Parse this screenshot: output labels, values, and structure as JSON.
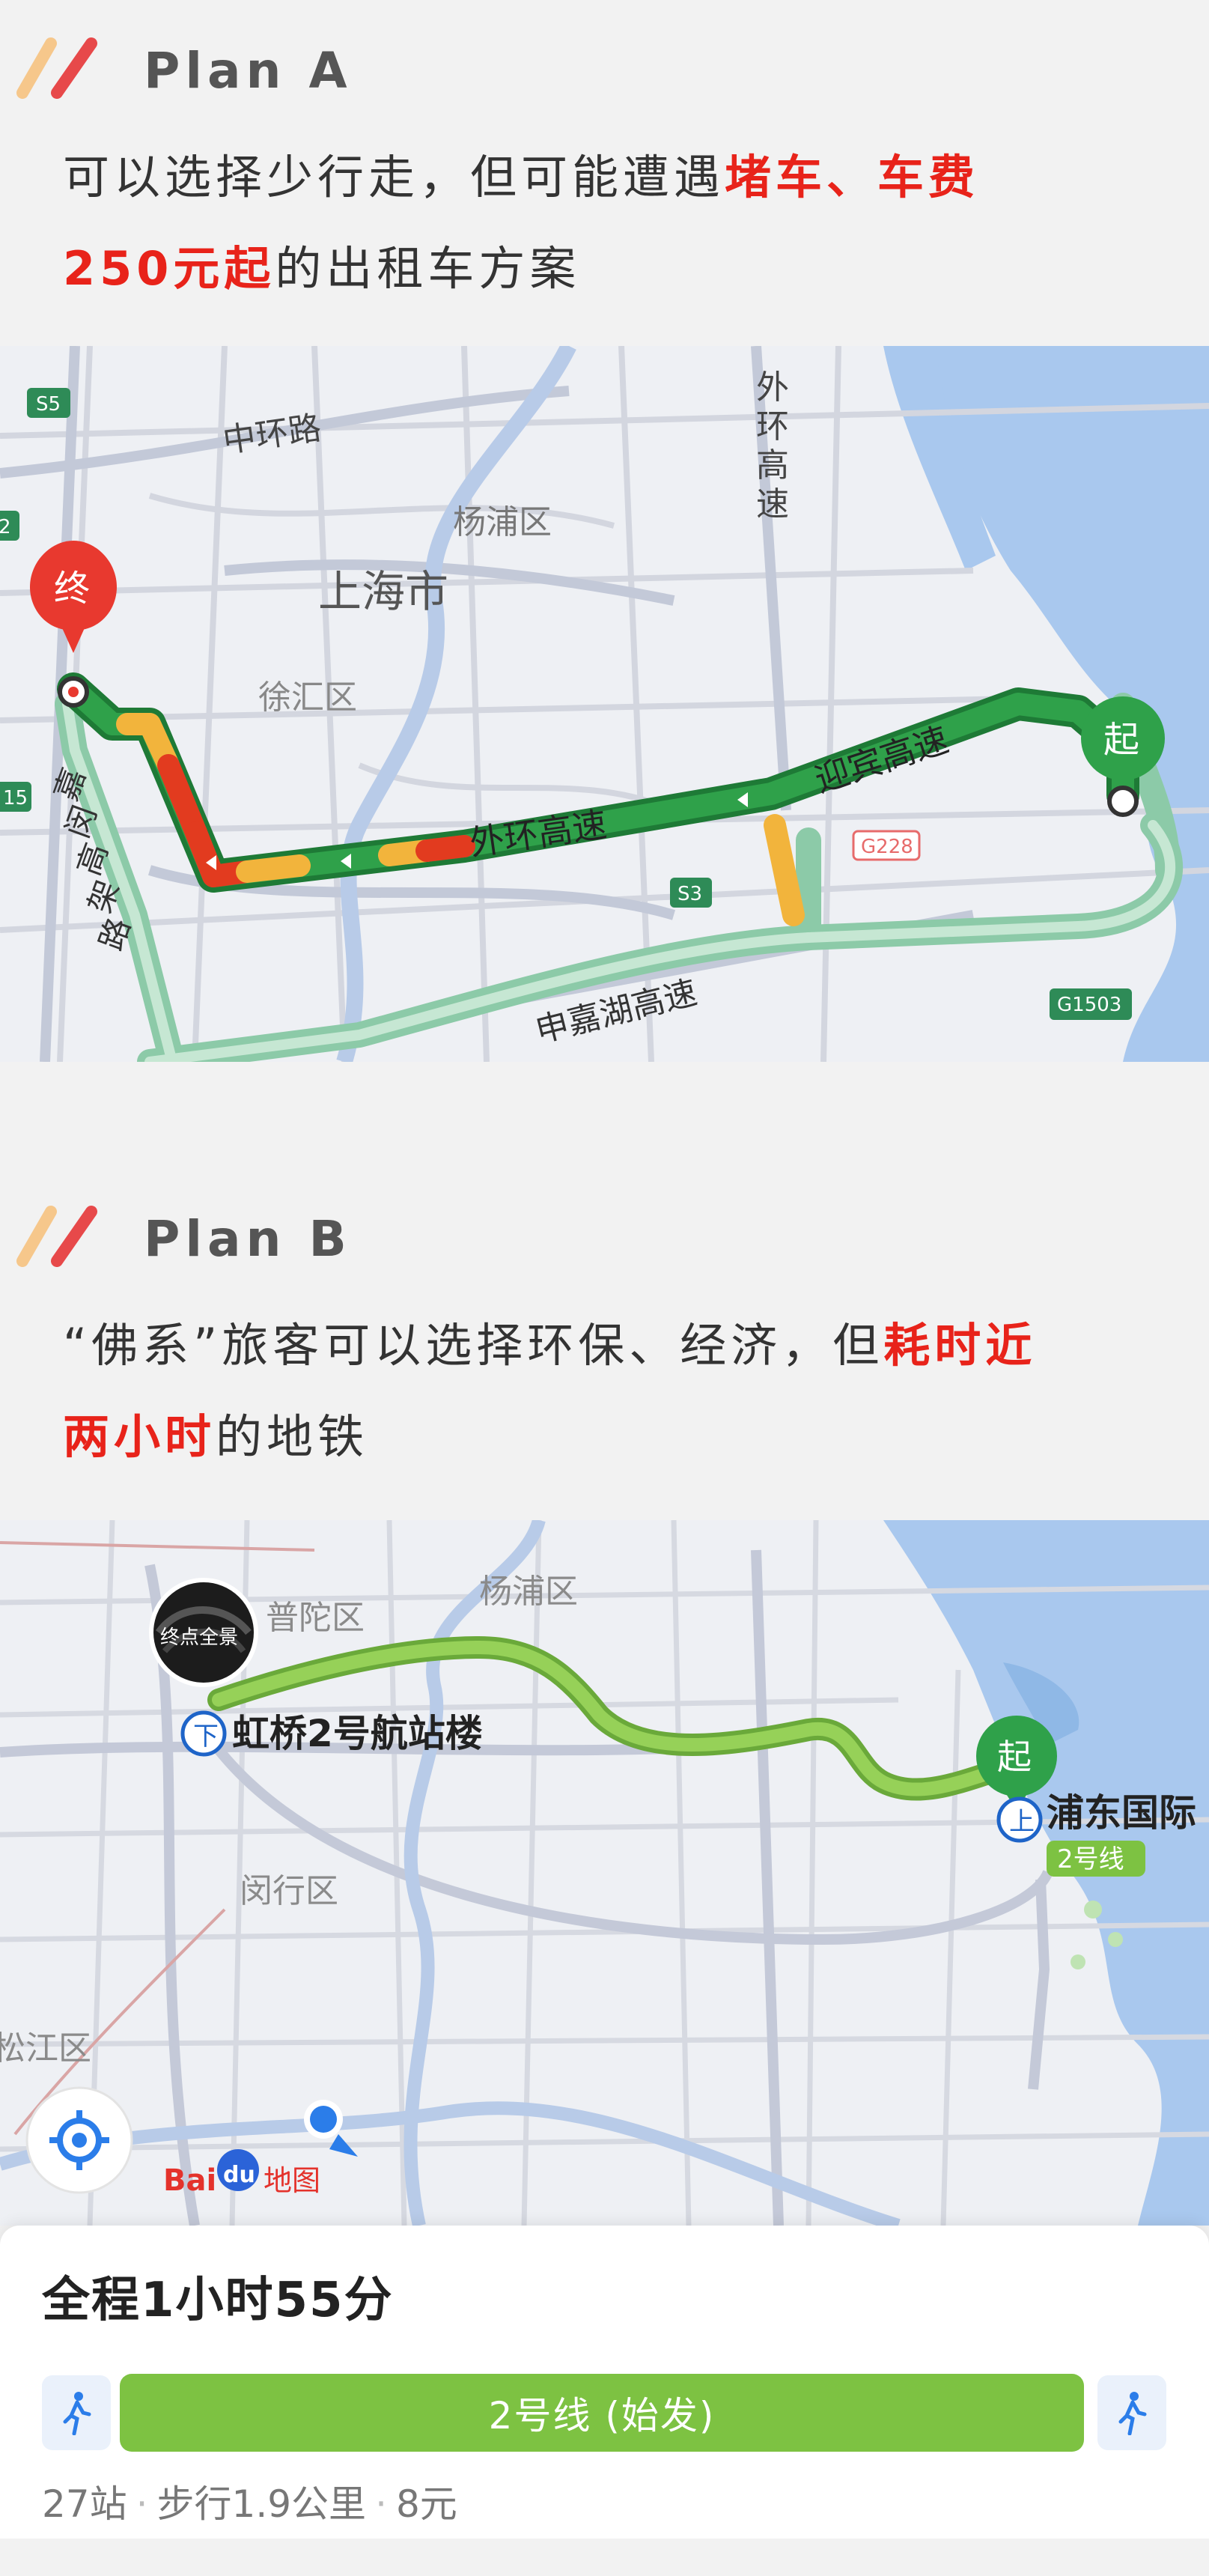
{
  "plan_a": {
    "title": "Plan  A",
    "desc_1": "可以选择少行走，但可能遭遇",
    "desc_hl_1": "堵车、车费",
    "desc_hl_2": "250元起",
    "desc_2": "的出租车方案",
    "map": {
      "labels": {
        "s5": "S5",
        "middle_ring": "中环路",
        "yangpu": "杨浦区",
        "shanghai": "上海市",
        "xuhui": "徐汇区",
        "outer_ring_v1": "外",
        "outer_ring_v2": "环",
        "outer_ring_v3": "高",
        "outer_ring_v4": "速",
        "outer_ring_h": "外环高速",
        "yingbin": "迎宾高速",
        "jiamin_1": "嘉",
        "jiamin_2": "闵",
        "jiamin_3": "高",
        "jiamin_4": "架",
        "jiamin_5": "路",
        "g228": "G228",
        "s3": "S3",
        "shenjiahu": "申嘉湖高速",
        "g1503": "G1503",
        "edge_15": "15",
        "edge_2": "2"
      },
      "end_marker": "终",
      "start_marker": "起"
    }
  },
  "plan_b": {
    "title": "Plan  B",
    "desc_1": "“佛系”旅客可以选择环保、经济，但",
    "desc_hl_1": "耗时近",
    "desc_hl_2": "两小时",
    "desc_2": "的地铁",
    "map": {
      "labels": {
        "putuo": "普陀区",
        "yangpu": "杨浦区",
        "hongqiao": "虹桥2号航站楼",
        "pudong": "浦东国际",
        "line2_badge": "2号线",
        "minhang": "闵行区",
        "songjiang": "松江区",
        "streetview": "终点全景",
        "start_marker": "起",
        "logo_bai": "Bai",
        "logo_du": "du",
        "logo_map": "地图"
      }
    }
  },
  "route_card": {
    "total_prefix": "全程",
    "total_time": "1小时55分",
    "line_label": "2号线 (始发)",
    "stations": "27站",
    "walk": "步行1.9公里",
    "fare": "8元"
  },
  "colors": {
    "highlight_red": "#e8231a",
    "route_green": "#2fa14a",
    "metro_green": "#7dc242",
    "jam_red": "#e23b1f",
    "slow_yellow": "#f2b43c"
  }
}
